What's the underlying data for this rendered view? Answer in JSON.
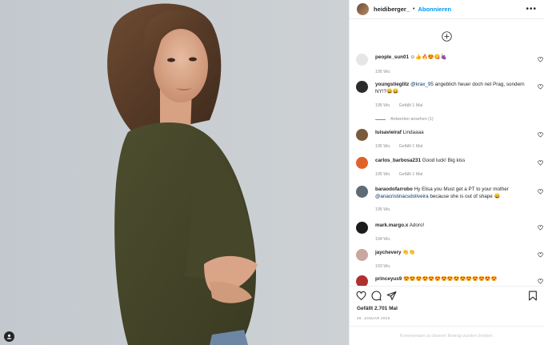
{
  "post": {
    "username": "heidiberger_",
    "follow_label": "Abonnieren",
    "more_label": "•••"
  },
  "comments": [
    {
      "user": "people_sun01",
      "text": " ☺👍🔥😍😋🍇",
      "time": "195 Wo.",
      "likes": "",
      "avatar_color": "#e6e6e6"
    },
    {
      "user": "youngstieglitz",
      "mention": "@krax_95",
      "text": " angeblich heuer doch net Prag, sondern NY!?😄😄",
      "time": "195 Wo.",
      "likes": "Gefällt 1 Mal",
      "avatar_color": "#2b2b2b"
    },
    {
      "user": "luisavieiraf",
      "text": " Lindaaaa",
      "time": "195 Wo.",
      "likes": "Gefällt 1 Mal",
      "avatar_color": "#7a5a3c"
    },
    {
      "user": "carlos_barbosa231",
      "text": " Good luck! Big kiss",
      "time": "195 Wo.",
      "likes": "Gefällt 1 Mal",
      "avatar_color": "#e0622a"
    },
    {
      "user": "baraodofarrobo",
      "text": " Hy Elisa you Must get a PT to your mother ",
      "mention": "@anacristinacsdoliveira",
      "text2": " because she is out of shape 😄",
      "time": "195 Wo.",
      "likes": "",
      "avatar_color": "#5f6a73"
    },
    {
      "user": "mark.margo.x",
      "text": " Adoro!",
      "time": "194 Wo.",
      "likes": "",
      "avatar_color": "#1c1c1c"
    },
    {
      "user": "jaychevery",
      "text": " 👏👏",
      "time": "193 Wo.",
      "likes": "",
      "avatar_color": "#c9a7a0"
    },
    {
      "user": "princeyus9",
      "text": " 😍😍😍😍😍😍😍😍😍😍😍😍😍😍😍",
      "time": "",
      "likes": "",
      "avatar_color": "#b03030"
    }
  ],
  "replies_label": "Antworten ansehen (1)",
  "likes_count": "Gefällt 2.701 Mal",
  "date": "29. JANUAR 2019",
  "comments_closed": "Kommentare zu diesem Beitrag wurden limitiert."
}
